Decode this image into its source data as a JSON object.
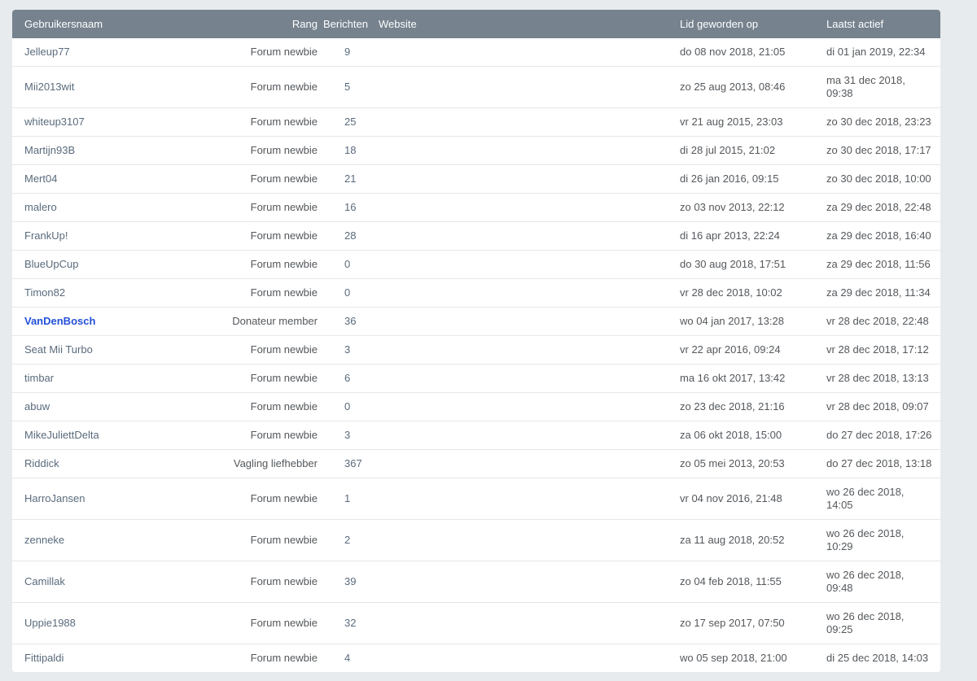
{
  "page": {
    "background": "#e8ebee"
  },
  "table": {
    "colors": {
      "header_bg": "#76828e",
      "header_text": "#ffffff",
      "row_bg": "#ffffff",
      "row_divider": "#e4e7ea",
      "link": "#5a6b7c",
      "text": "#54585c",
      "highlight_link": "#2350d7",
      "page_bg": "#e8ebee"
    },
    "columns": {
      "username": "Gebruikersnaam",
      "rank": "Rang",
      "posts": "Berichten",
      "website": "Website",
      "joined": "Lid geworden op",
      "last_active": "Laatst actief"
    },
    "rows": [
      {
        "username": "Jelleup77",
        "rank": "Forum newbie",
        "posts": "9",
        "website": "",
        "joined": "do 08 nov 2018, 21:05",
        "last_active": "di 01 jan 2019, 22:34",
        "highlight": false
      },
      {
        "username": "Mii2013wit",
        "rank": "Forum newbie",
        "posts": "5",
        "website": "",
        "joined": "zo 25 aug 2013, 08:46",
        "last_active": "ma 31 dec 2018,\n09:38",
        "highlight": false
      },
      {
        "username": "whiteup3107",
        "rank": "Forum newbie",
        "posts": "25",
        "website": "",
        "joined": "vr 21 aug 2015, 23:03",
        "last_active": "zo 30 dec 2018, 23:23",
        "highlight": false
      },
      {
        "username": "Martijn93B",
        "rank": "Forum newbie",
        "posts": "18",
        "website": "",
        "joined": "di 28 jul 2015, 21:02",
        "last_active": "zo 30 dec 2018, 17:17",
        "highlight": false
      },
      {
        "username": "Mert04",
        "rank": "Forum newbie",
        "posts": "21",
        "website": "",
        "joined": "di 26 jan 2016, 09:15",
        "last_active": "zo 30 dec 2018, 10:00",
        "highlight": false
      },
      {
        "username": "malero",
        "rank": "Forum newbie",
        "posts": "16",
        "website": "",
        "joined": "zo 03 nov 2013, 22:12",
        "last_active": "za 29 dec 2018, 22:48",
        "highlight": false
      },
      {
        "username": "FrankUp!",
        "rank": "Forum newbie",
        "posts": "28",
        "website": "",
        "joined": "di 16 apr 2013, 22:24",
        "last_active": "za 29 dec 2018, 16:40",
        "highlight": false
      },
      {
        "username": "BlueUpCup",
        "rank": "Forum newbie",
        "posts": "0",
        "website": "",
        "joined": "do 30 aug 2018, 17:51",
        "last_active": "za 29 dec 2018, 11:56",
        "highlight": false
      },
      {
        "username": "Timon82",
        "rank": "Forum newbie",
        "posts": "0",
        "website": "",
        "joined": "vr 28 dec 2018, 10:02",
        "last_active": "za 29 dec 2018, 11:34",
        "highlight": false
      },
      {
        "username": "VanDenBosch",
        "rank": "Donateur member",
        "posts": "36",
        "website": "",
        "joined": "wo 04 jan 2017, 13:28",
        "last_active": "vr 28 dec 2018, 22:48",
        "highlight": true
      },
      {
        "username": "Seat Mii Turbo",
        "rank": "Forum newbie",
        "posts": "3",
        "website": "",
        "joined": "vr 22 apr 2016, 09:24",
        "last_active": "vr 28 dec 2018, 17:12",
        "highlight": false
      },
      {
        "username": "timbar",
        "rank": "Forum newbie",
        "posts": "6",
        "website": "",
        "joined": "ma 16 okt 2017, 13:42",
        "last_active": "vr 28 dec 2018, 13:13",
        "highlight": false
      },
      {
        "username": "abuw",
        "rank": "Forum newbie",
        "posts": "0",
        "website": "",
        "joined": "zo 23 dec 2018, 21:16",
        "last_active": "vr 28 dec 2018, 09:07",
        "highlight": false
      },
      {
        "username": "MikeJuliettDelta",
        "rank": "Forum newbie",
        "posts": "3",
        "website": "",
        "joined": "za 06 okt 2018, 15:00",
        "last_active": "do 27 dec 2018, 17:26",
        "highlight": false
      },
      {
        "username": "Riddick",
        "rank": "Vagling liefhebber",
        "posts": "367",
        "website": "",
        "joined": "zo 05 mei 2013, 20:53",
        "last_active": "do 27 dec 2018, 13:18",
        "highlight": false
      },
      {
        "username": "HarroJansen",
        "rank": "Forum newbie",
        "posts": "1",
        "website": "",
        "joined": "vr 04 nov 2016, 21:48",
        "last_active": "wo 26 dec 2018,\n14:05",
        "highlight": false
      },
      {
        "username": "zenneke",
        "rank": "Forum newbie",
        "posts": "2",
        "website": "",
        "joined": "za 11 aug 2018, 20:52",
        "last_active": "wo 26 dec 2018,\n10:29",
        "highlight": false
      },
      {
        "username": "Camillak",
        "rank": "Forum newbie",
        "posts": "39",
        "website": "",
        "joined": "zo 04 feb 2018, 11:55",
        "last_active": "wo 26 dec 2018,\n09:48",
        "highlight": false
      },
      {
        "username": "Uppie1988",
        "rank": "Forum newbie",
        "posts": "32",
        "website": "",
        "joined": "zo 17 sep 2017, 07:50",
        "last_active": "wo 26 dec 2018,\n09:25",
        "highlight": false
      },
      {
        "username": "Fittipaldi",
        "rank": "Forum newbie",
        "posts": "4",
        "website": "",
        "joined": "wo 05 sep 2018, 21:00",
        "last_active": "di 25 dec 2018, 14:03",
        "highlight": false
      }
    ]
  }
}
